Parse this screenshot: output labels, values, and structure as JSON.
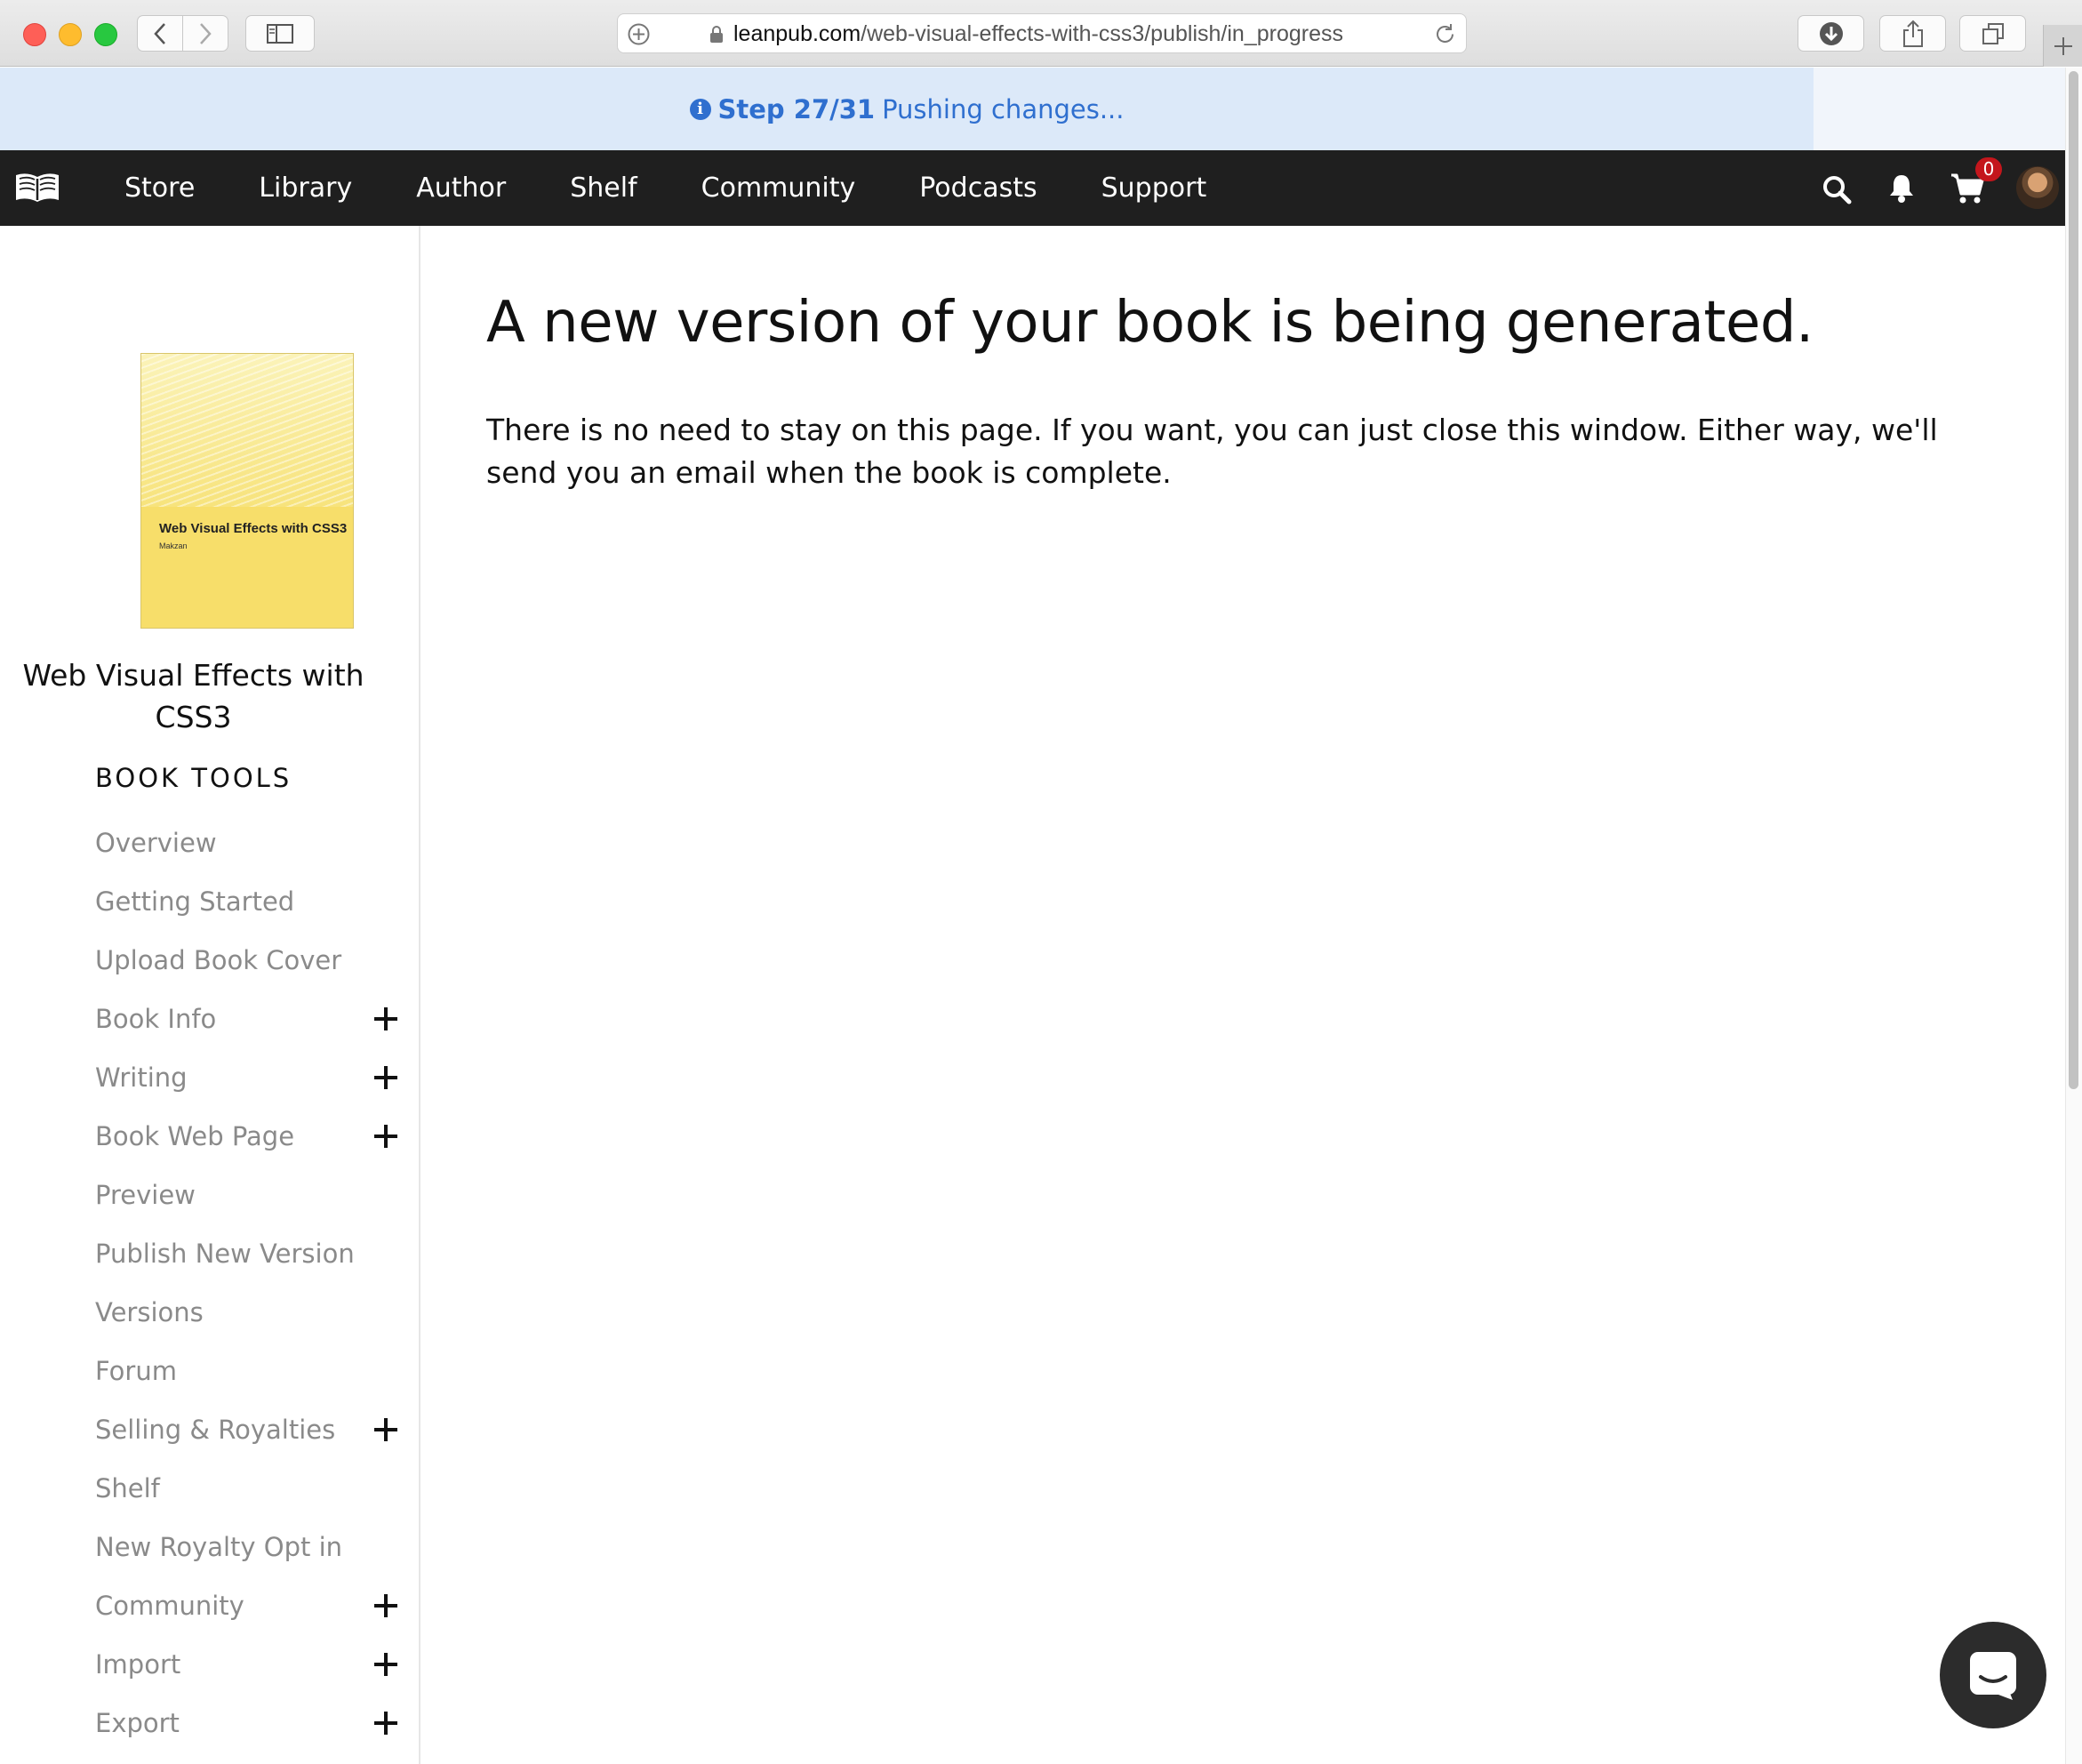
{
  "browser": {
    "url_host": "leanpub.com",
    "url_path": "/web-visual-effects-with-css3/publish/in_progress"
  },
  "banner": {
    "step": "Step 27/31",
    "message": "Pushing changes..."
  },
  "nav": {
    "items": [
      "Store",
      "Library",
      "Author",
      "Shelf",
      "Community",
      "Podcasts",
      "Support"
    ],
    "cart_count": "0"
  },
  "sidebar": {
    "cover_title": "Web Visual Effects with CSS3",
    "cover_author": "Makzan",
    "book_title": "Web Visual Effects with CSS3",
    "heading": "BOOK TOOLS",
    "items": [
      {
        "label": "Overview",
        "expandable": false
      },
      {
        "label": "Getting Started",
        "expandable": false
      },
      {
        "label": "Upload Book Cover",
        "expandable": false
      },
      {
        "label": "Book Info",
        "expandable": true
      },
      {
        "label": "Writing",
        "expandable": true
      },
      {
        "label": "Book Web Page",
        "expandable": true
      },
      {
        "label": "Preview",
        "expandable": false
      },
      {
        "label": "Publish New Version",
        "expandable": false
      },
      {
        "label": "Versions",
        "expandable": false
      },
      {
        "label": "Forum",
        "expandable": false
      },
      {
        "label": "Selling & Royalties",
        "expandable": true
      },
      {
        "label": "Shelf",
        "expandable": false
      },
      {
        "label": "New Royalty Opt in",
        "expandable": false
      },
      {
        "label": "Community",
        "expandable": true
      },
      {
        "label": "Import",
        "expandable": true
      },
      {
        "label": "Export",
        "expandable": true
      }
    ]
  },
  "main": {
    "title": "A new version of your book is being generated.",
    "body": "There is no need to stay on this page. If you want, you can just close this window. Either way, we'll send you an email when the book is complete."
  },
  "colors": {
    "banner_bg": "#dce9f9",
    "banner_text": "#2f6fcf",
    "nav_bg": "#1f1f1f",
    "badge": "#c4161c"
  }
}
